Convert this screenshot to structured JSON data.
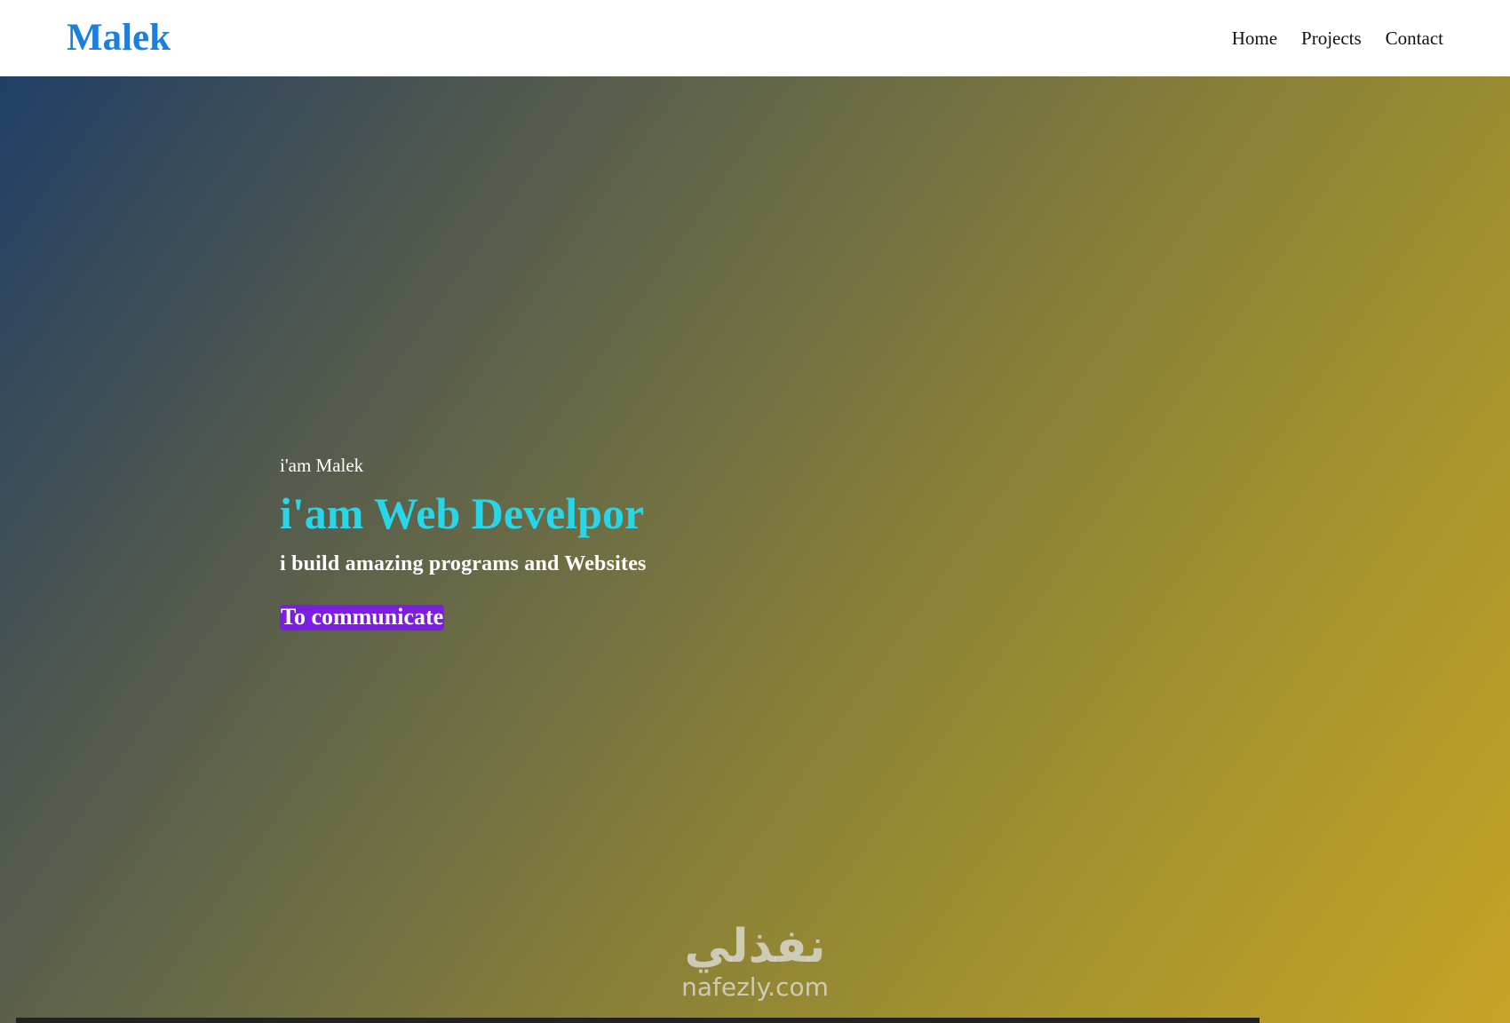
{
  "header": {
    "logo": "Malek",
    "nav": [
      {
        "label": "Home"
      },
      {
        "label": "Projects"
      },
      {
        "label": "Contact"
      }
    ]
  },
  "hero": {
    "intro": "i'am Malek",
    "headline": "i'am Web Develpor",
    "tagline": "i build amazing programs and Websites",
    "cta_label": "To communicate"
  },
  "watermark": {
    "arabic": "نفذلي",
    "latin": "nafezly.com"
  },
  "colors": {
    "logo": "#1a7fe0",
    "headline": "#27d6e8",
    "cta_bg": "#7a1fe0",
    "gradient_start": "#1f3f66",
    "gradient_end": "#c8a228"
  }
}
